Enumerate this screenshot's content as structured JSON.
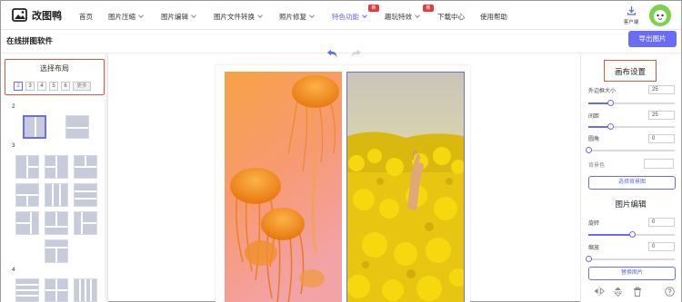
{
  "brand": {
    "name": "改图鸭",
    "accent": "#6a6cf5",
    "highlight": "#e2543d"
  },
  "nav": {
    "items": [
      {
        "label": "首页"
      },
      {
        "label": "图片压缩"
      },
      {
        "label": "图片编辑"
      },
      {
        "label": "图片文件转换"
      },
      {
        "label": "照片修复"
      },
      {
        "label": "特色功能",
        "badge": "新"
      },
      {
        "label": "趣玩特效",
        "badge": "新"
      },
      {
        "label": "下载中心"
      },
      {
        "label": "使用帮助"
      }
    ],
    "client_label": "客户端"
  },
  "header": {
    "title": "在线拼图软件",
    "export_label": "导出图片"
  },
  "layout_panel": {
    "title": "选择布局",
    "counts": [
      "2",
      "3",
      "4",
      "5",
      "6"
    ],
    "selected_count": "2",
    "more_label": "更多",
    "sections": [
      "2",
      "3",
      "4"
    ]
  },
  "canvas_settings": {
    "title": "画布设置",
    "outer_size_label": "外边框大小",
    "outer_size_value": "25",
    "outer_size_level": 0.25,
    "gap_label": "间距",
    "gap_value": "25",
    "gap_level": 0.25,
    "radius_label": "圆角",
    "radius_value": "0",
    "radius_level": 0,
    "bg_label": "背景色",
    "bg_button": "选择背景图"
  },
  "image_edit": {
    "title": "图片编辑",
    "rotate_label": "旋转",
    "rotate_value": "0",
    "rotate_level": 0.5,
    "zoom_label": "缩放",
    "zoom_value": "0",
    "zoom_level": 0,
    "replace_button": "替换图片"
  },
  "icons": [
    "undo-icon",
    "redo-icon",
    "download-icon",
    "flip-horizontal-icon",
    "flip-vertical-icon",
    "trash-icon",
    "help-icon"
  ]
}
